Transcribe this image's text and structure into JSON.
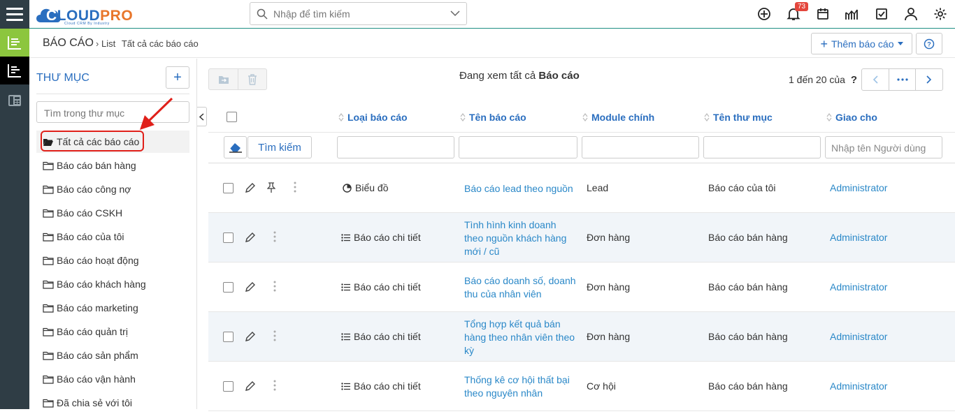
{
  "topbar": {
    "logo_text": "CLOUDPRO",
    "logo_sub": "Cloud CRM By Industry",
    "search_placeholder": "Nhập để tìm kiếm",
    "notification_count": "73"
  },
  "breadcrumb": {
    "module": "BÁO CÁO",
    "list": "List",
    "current": "Tất cả các báo cáo"
  },
  "actions": {
    "add_report": "Thêm báo cáo",
    "help": "?"
  },
  "sidebar": {
    "title": "THƯ MỤC",
    "add": "+",
    "search_placeholder": "Tìm trong thư mục",
    "folders": [
      "Tất cả các báo cáo",
      "Báo cáo bán hàng",
      "Báo cáo công nợ",
      "Báo cáo CSKH",
      "Báo cáo của tôi",
      "Báo cáo hoạt động",
      "Báo cáo khách hàng",
      "Báo cáo marketing",
      "Báo cáo quản trị",
      "Báo cáo sản phẩm",
      "Báo cáo vận hành",
      "Đã chia sẻ với tôi"
    ]
  },
  "list": {
    "viewing_prefix": "Đang xem tất cả",
    "viewing_module": "Báo cáo",
    "page_info": "1 đến 20 của",
    "page_help": "?",
    "columns": [
      "Loại báo cáo",
      "Tên báo cáo",
      "Module chính",
      "Tên thư mục",
      "Giao cho"
    ],
    "find_button": "Tìm kiếm",
    "assignee_placeholder": "Nhập tên Người dùng",
    "rows": [
      {
        "type": "Biểu đồ",
        "name": "Báo cáo lead theo nguồn",
        "module": "Lead",
        "folder": "Báo cáo của tôi",
        "assignee": "Administrator"
      },
      {
        "type": "Báo cáo chi tiết",
        "name": "Tình hình kinh doanh theo nguồn khách hàng mới / cũ",
        "module": "Đơn hàng",
        "folder": "Báo cáo bán hàng",
        "assignee": "Administrator"
      },
      {
        "type": "Báo cáo chi tiết",
        "name": "Báo cáo doanh số, doanh thu của nhân viên",
        "module": "Đơn hàng",
        "folder": "Báo cáo bán hàng",
        "assignee": "Administrator"
      },
      {
        "type": "Báo cáo chi tiết",
        "name": "Tổng hợp kết quả bán hàng theo nhân viên theo kỳ",
        "module": "Đơn hàng",
        "folder": "Báo cáo bán hàng",
        "assignee": "Administrator"
      },
      {
        "type": "Báo cáo chi tiết",
        "name": "Thống kê cơ hội thất bại theo nguyên nhân",
        "module": "Cơ hội",
        "folder": "Báo cáo bán hàng",
        "assignee": "Administrator"
      }
    ]
  },
  "colors": {
    "accent": "#2a6ebf",
    "link": "#2a88c8",
    "rail": "#2f3d45",
    "rail_active": "#8cc63e",
    "badge": "#e4463c",
    "highlight": "#e0201a"
  }
}
